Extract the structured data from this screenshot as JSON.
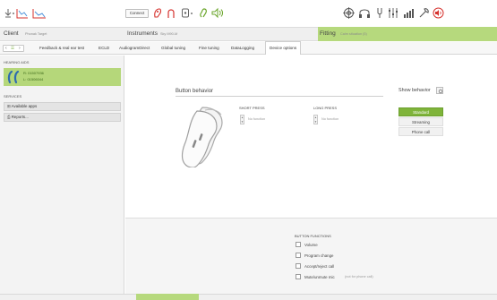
{
  "toolbar": {
    "left_icons": [
      "arrow-down-icon",
      "audiogram-icon",
      "audiogram-lines-icon"
    ],
    "connect_label": "Connect",
    "center_icons": [
      "hearing-aid-red-icon",
      "feedback-red-icon",
      "hearing-aid-settings-icon",
      "ear-green-icon",
      "speaker-green-icon"
    ],
    "right_icons": [
      "target-icon",
      "headset-icon",
      "tuning-fork-icon",
      "equalizer-icon",
      "gain-icon",
      "tools-icon",
      "speaker-red-icon"
    ]
  },
  "header": {
    "client_title": "Client",
    "client_name": "Phonak Target",
    "instruments_title": "Instruments",
    "instruments_name": "Sky M90-M",
    "fitting_title": "Fitting",
    "fitting_sub": "Calm situation (5)"
  },
  "tabs": {
    "nav_back": "‹",
    "nav_mid": "☰",
    "nav_next": "›",
    "items": [
      "Feedback & real ear test",
      "ECLD",
      "AudiogramDirect",
      "Global tuning",
      "Fine tuning",
      "DataLogging",
      "Device options"
    ],
    "active": "Device options"
  },
  "left_panel": {
    "hearing_aids_title": "HEARING AIDS",
    "ha_line1": "R: 01507936",
    "ha_line2": "L: 01506044",
    "services_title": "SERVICES",
    "services": [
      "Available apps",
      "Reports..."
    ]
  },
  "main": {
    "button_behavior_title": "Button behavior",
    "short_press_title": "SHORT PRESS",
    "short_press_value": "No function",
    "long_press_title": "LONG PRESS",
    "long_press_value": "No function",
    "show_behavior_label": "Show behavior",
    "show_behavior_items": [
      "Standard",
      "Streaming",
      "Phone call"
    ],
    "show_behavior_active": "Standard"
  },
  "button_functions": {
    "title": "BUTTON FUNCTIONS",
    "items": [
      "Volume",
      "Program change",
      "Accept/reject call",
      "Mute/unmute mic"
    ],
    "mute_note": "(not for phone call)"
  },
  "colors": {
    "accent_green": "#7fb43a",
    "light_green": "#b6d97d",
    "red_icon": "#d6322e"
  }
}
